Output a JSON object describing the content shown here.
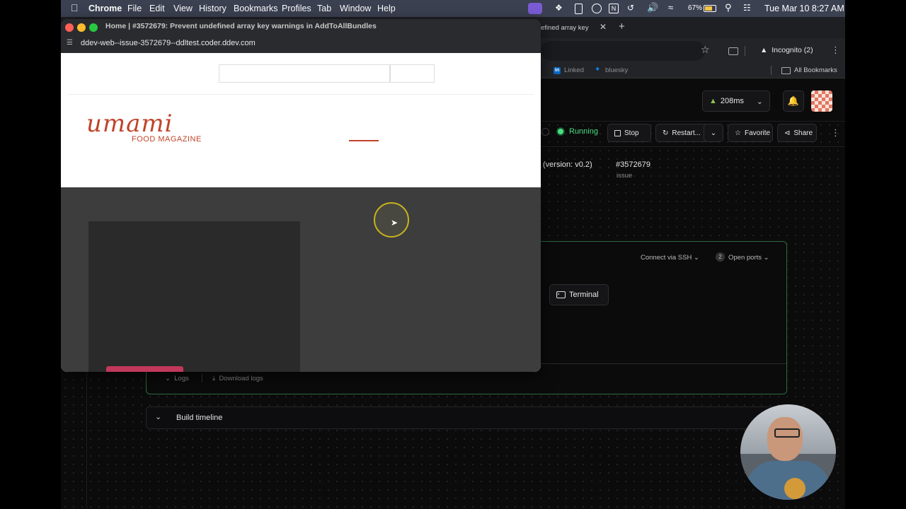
{
  "menubar": {
    "app": "Chrome",
    "items": [
      "File",
      "Edit",
      "View",
      "History",
      "Bookmarks",
      "Profiles",
      "Tab",
      "Window",
      "Help"
    ],
    "battery": "67%",
    "datetime": "Tue Mar 10  8:27 AM"
  },
  "coder_browser": {
    "tab_partial_title": "efined array key",
    "incognito_label": "Incognito (2)",
    "bookmarks": [
      "Linked",
      "bluesky"
    ],
    "all_bookmarks": "All Bookmarks",
    "latency": "208ms",
    "status": "Running",
    "stop_label": "Stop",
    "restart_label": "Restart...",
    "favorite_label": "Favorite",
    "share_label": "Share",
    "version_text": "(version: v0.2)",
    "issue_number": "#3572679",
    "issue_label": "issue",
    "connect_ssh": "Connect via SSH",
    "open_ports_count": "2",
    "open_ports_label": "Open ports",
    "terminal_label": "Terminal",
    "logs_label": "Logs",
    "download_logs": "Download logs",
    "build_timeline": "Build timeline",
    "colors": {
      "accent_green": "#4ade80",
      "brand_red": "#c0432a"
    }
  },
  "overlay_window": {
    "title": "Home | #3572679: Prevent undefined array key warnings in AddToAllBundles",
    "url": "ddev-web--issue-3572679--ddltest.coder.ddev.com",
    "logo_word": "umami",
    "logo_sub": "FOOD MAGAZINE"
  }
}
